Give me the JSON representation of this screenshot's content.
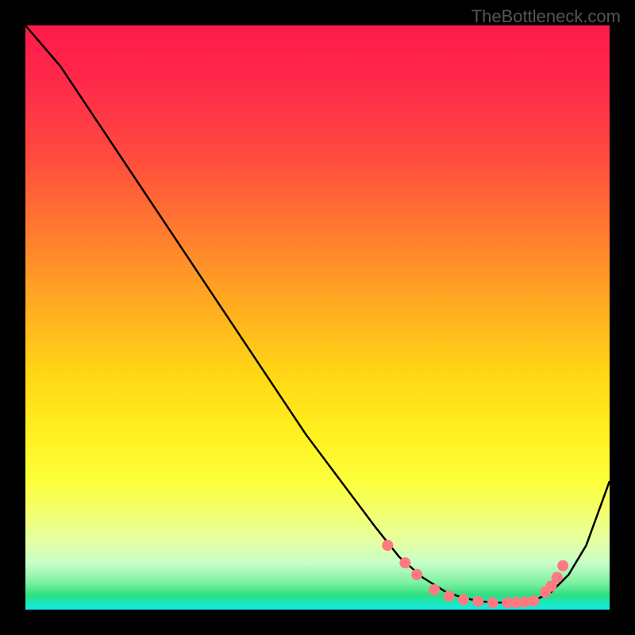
{
  "watermark": "TheBottleneck.com",
  "chart_data": {
    "type": "line",
    "title": "",
    "xlabel": "",
    "ylabel": "",
    "xlim": [
      0,
      100
    ],
    "ylim": [
      0,
      100
    ],
    "grid": false,
    "series": [
      {
        "name": "curve",
        "x": [
          0,
          6,
          12,
          18,
          24,
          30,
          36,
          42,
          48,
          54,
          60,
          64,
          68,
          72,
          75,
          78,
          81,
          84,
          87,
          90,
          93,
          96,
          100
        ],
        "y": [
          100,
          93,
          84,
          75,
          66,
          57,
          48,
          39,
          30,
          22,
          14,
          9,
          5.5,
          3,
          2,
          1.4,
          1.2,
          1.2,
          1.5,
          3,
          6,
          11,
          22
        ],
        "color": "#000000"
      }
    ],
    "markers": {
      "name": "dots",
      "x": [
        62,
        65,
        67,
        70,
        72.5,
        75,
        77.5,
        80,
        82.5,
        84,
        85.5,
        87,
        89,
        90,
        91,
        92
      ],
      "y": [
        11,
        8,
        6,
        3.4,
        2.3,
        1.7,
        1.4,
        1.2,
        1.2,
        1.2,
        1.3,
        1.5,
        3,
        4,
        5.5,
        7.5
      ],
      "color": "#ff7a80",
      "size": 7
    },
    "background_gradient": {
      "stops": [
        {
          "pos": 0,
          "color": "#ff1a4a"
        },
        {
          "pos": 50,
          "color": "#ffd815"
        },
        {
          "pos": 80,
          "color": "#fdff3c"
        },
        {
          "pos": 97,
          "color": "#2ee080"
        },
        {
          "pos": 100,
          "color": "#19e8e8"
        }
      ]
    }
  }
}
